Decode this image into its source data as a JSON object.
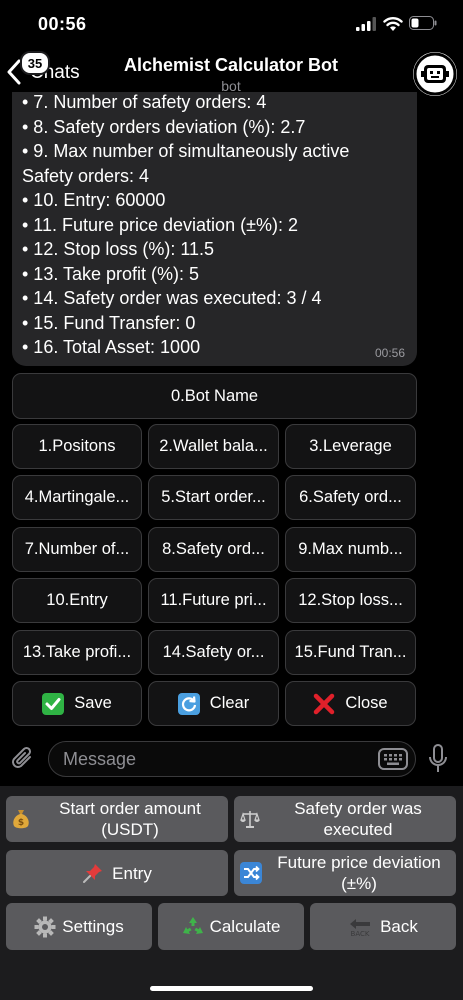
{
  "status_bar": {
    "time": "00:56"
  },
  "header": {
    "back_badge": "35",
    "back_label": "Chats",
    "title": "Alchemist Calculator Bot",
    "subtitle": "bot"
  },
  "message": {
    "lines": [
      "• 7. Number of safety orders: 4",
      "• 8. Safety orders deviation (%): 2.7",
      "• 9. Max number of simultaneously active",
      "Safety orders: 4",
      "• 10. Entry: 60000",
      "• 11. Future price deviation (±%): 2",
      "• 12. Stop loss (%): 11.5",
      "• 13. Take profit (%): 5",
      "• 14. Safety order was executed: 3 / 4",
      "• 15. Fund Transfer: 0",
      "• 16. Total Asset: 1000"
    ],
    "time": "00:56"
  },
  "inline_keyboard": {
    "bot_name": "0.Bot Name",
    "rows": [
      [
        "1.Positons",
        "2.Wallet bala...",
        "3.Leverage"
      ],
      [
        "4.Martingale...",
        "5.Start order...",
        "6.Safety ord..."
      ],
      [
        "7.Number of...",
        "8.Safety ord...",
        "9.Max numb..."
      ],
      [
        "10.Entry",
        "11.Future pri...",
        "12.Stop loss..."
      ],
      [
        "13.Take profi...",
        "14.Safety or...",
        "15.Fund Tran..."
      ]
    ],
    "save": "Save",
    "clear": "Clear",
    "close": "Close",
    "icons": {
      "save": "check-mark-icon",
      "clear": "refresh-icon",
      "close": "cross-icon"
    },
    "colors": {
      "save": "#2fb344",
      "clear": "#4a9fe0",
      "close": "#e0202a"
    }
  },
  "input": {
    "placeholder": "Message"
  },
  "reply_keyboard": {
    "start_order": "Start order amount (USDT)",
    "safety_executed": "Safety order was executed",
    "entry": "Entry",
    "future_dev": "Future price deviation (±%)",
    "settings": "Settings",
    "calculate": "Calculate",
    "back": "Back",
    "back_icon_text": "BACK",
    "icons": {
      "start_order": "money-bag-icon",
      "safety_executed": "balance-scale-icon",
      "entry": "pushpin-icon",
      "future_dev": "shuffle-icon",
      "settings": "gear-icon",
      "calculate": "recycle-icon",
      "back": "back-arrow-icon"
    }
  }
}
